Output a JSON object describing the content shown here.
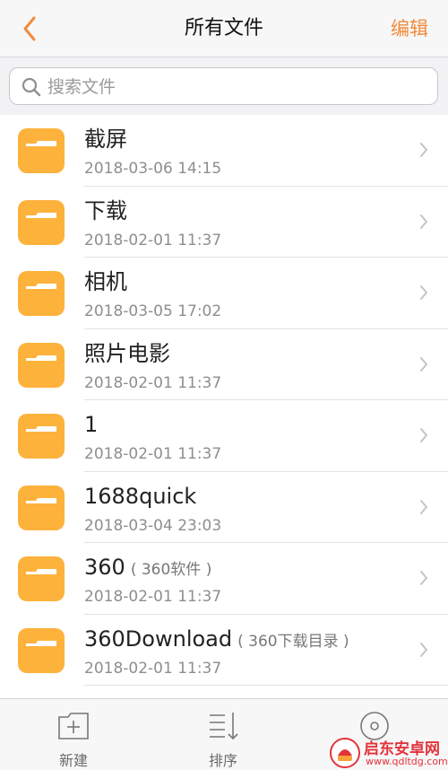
{
  "colors": {
    "accent": "#f08a3c",
    "folder": "#fdb23c",
    "folder_tab": "#ffffff"
  },
  "navbar": {
    "title": "所有文件",
    "edit_label": "编辑",
    "back_icon": "chevron-left-icon"
  },
  "search": {
    "placeholder": "搜索文件",
    "icon": "search-icon"
  },
  "files": [
    {
      "name": "截屏",
      "note": "",
      "date": "2018-03-06 14:15"
    },
    {
      "name": "下载",
      "note": "",
      "date": "2018-02-01 11:37"
    },
    {
      "name": "相机",
      "note": "",
      "date": "2018-03-05 17:02"
    },
    {
      "name": "照片电影",
      "note": "",
      "date": "2018-02-01 11:37"
    },
    {
      "name": "1",
      "note": "",
      "date": "2018-02-01 11:37"
    },
    {
      "name": "1688quick",
      "note": "",
      "date": "2018-03-04 23:03"
    },
    {
      "name": "360",
      "note": "( 360软件 )",
      "date": "2018-02-01 11:37"
    },
    {
      "name": "360Download",
      "note": "( 360下载目录 )",
      "date": "2018-02-01 11:37"
    }
  ],
  "toolbar": {
    "new_label": "新建",
    "sort_label": "排序"
  },
  "watermark": {
    "title": "启东安卓网",
    "url": "www.qdltdg.com"
  }
}
